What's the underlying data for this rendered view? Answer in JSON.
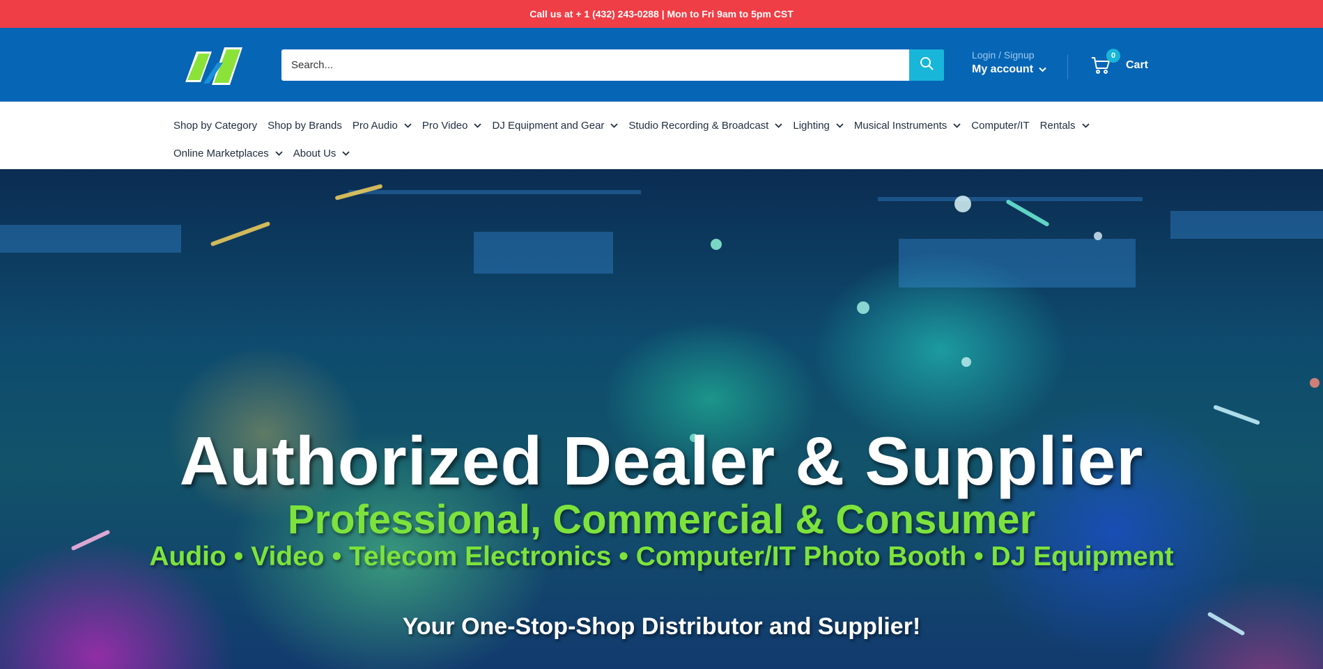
{
  "announcement": {
    "text": "Call us at + 1 (432) 243-0288 | Mon to Fri 9am to 5pm CST"
  },
  "header": {
    "search_placeholder": "Search...",
    "account": {
      "login_label": "Login / Signup",
      "my_account_label": "My account"
    },
    "cart": {
      "count": "0",
      "label": "Cart"
    }
  },
  "nav": {
    "row1": [
      {
        "label": "Shop by Category",
        "dropdown": false
      },
      {
        "label": "Shop by Brands",
        "dropdown": false
      },
      {
        "label": "Pro Audio",
        "dropdown": true
      },
      {
        "label": "Pro Video",
        "dropdown": true
      },
      {
        "label": "DJ Equipment and Gear",
        "dropdown": true
      },
      {
        "label": "Studio Recording & Broadcast",
        "dropdown": true
      },
      {
        "label": "Lighting",
        "dropdown": true
      },
      {
        "label": "Musical Instruments",
        "dropdown": true
      },
      {
        "label": "Computer/IT",
        "dropdown": false
      },
      {
        "label": "Rentals",
        "dropdown": true
      }
    ],
    "row2": [
      {
        "label": "Online Marketplaces",
        "dropdown": true
      },
      {
        "label": "About Us",
        "dropdown": true
      }
    ]
  },
  "hero": {
    "headline": "Authorized Dealer & Supplier",
    "subheadline": "Professional, Commercial & Consumer",
    "categories_line": "Audio • Video • Telecom Electronics • Computer/IT Photo Booth • DJ Equipment",
    "tagline": "Your One-Stop-Shop Distributor and Supplier!"
  },
  "colors": {
    "announcement_bg": "#ef3e46",
    "header_bg": "#0665b5",
    "accent": "#18b6d8",
    "hero_green": "#7de33c"
  },
  "icons": [
    "brand-logo",
    "search-icon",
    "chevron-down-icon",
    "cart-icon"
  ]
}
